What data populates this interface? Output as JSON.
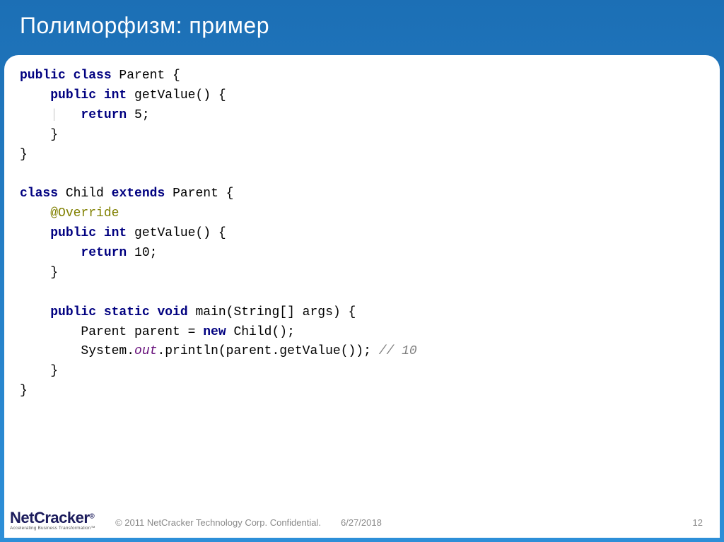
{
  "title": "Полиморфизм: пример",
  "code": {
    "l1": {
      "a": "public class",
      "b": " Parent {"
    },
    "l2": {
      "a": "public int",
      "b": " getValue() {"
    },
    "l3": {
      "a": "return",
      "b": " 5;"
    },
    "l4": "}",
    "l5": "}",
    "l7": {
      "a": "class",
      "b": " Child ",
      "c": "extends",
      "d": " Parent {"
    },
    "l8": "@Override",
    "l9": {
      "a": "public int",
      "b": " getValue() {"
    },
    "l10": {
      "a": "return",
      "b": " 10;"
    },
    "l11": "}",
    "l13": {
      "a": "public static void",
      "b": " main(String[] args) {"
    },
    "l14": {
      "a": "Parent parent = ",
      "b": "new",
      "c": " Child();"
    },
    "l15": {
      "a": "System.",
      "b": "out",
      "c": ".println(parent.getValue()); ",
      "d": "// 10"
    },
    "l16": "}",
    "l17": "}"
  },
  "footer": {
    "logo_main_a": "Net",
    "logo_main_b": "Cracker",
    "logo_reg": "®",
    "logo_sub": "Accelerating Business Transformation™",
    "copyright": "© 2011 NetCracker Technology Corp. Confidential.",
    "date": "6/27/2018",
    "page": "12"
  }
}
